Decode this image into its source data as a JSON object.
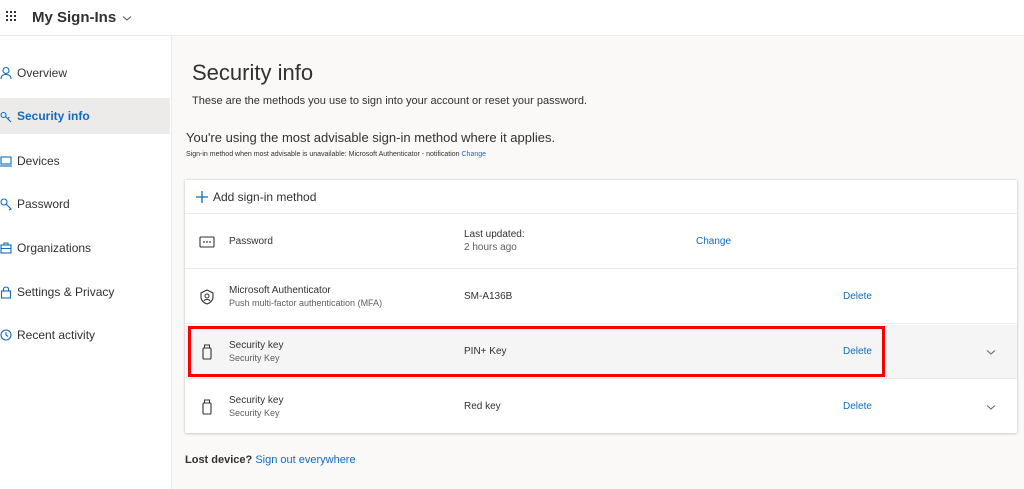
{
  "header": {
    "app_title": "My Sign-Ins",
    "icons": [
      "app-launcher-icon",
      "chevron-down-icon"
    ]
  },
  "sidebar": {
    "items": [
      {
        "label": "Overview",
        "icon": "person-icon",
        "active": false
      },
      {
        "label": "Security info",
        "icon": "key-pen-icon",
        "active": true
      },
      {
        "label": "Devices",
        "icon": "laptop-icon",
        "active": false
      },
      {
        "label": "Password",
        "icon": "password-key-icon",
        "active": false
      },
      {
        "label": "Organizations",
        "icon": "briefcase-icon",
        "active": false
      },
      {
        "label": "Settings & Privacy",
        "icon": "lock-icon",
        "active": false
      },
      {
        "label": "Recent activity",
        "icon": "clock-icon",
        "active": false
      }
    ]
  },
  "main": {
    "title": "Security info",
    "subtitle": "These are the methods you use to sign into your account or reset your password.",
    "advisable_text": "You're using the most advisable sign-in method where it applies.",
    "advisable_sub": "Sign-in method when most advisable is unavailable: Microsoft Authenticator - notification",
    "advisable_change": "Change",
    "add_method_label": "Add sign-in method",
    "methods": [
      {
        "name": "Password",
        "description": "",
        "icon": "password-dots-icon",
        "detail_top": "Last updated:",
        "detail_bottom": "2 hours ago",
        "action": "Change"
      },
      {
        "name": "Microsoft Authenticator",
        "description": "Push multi-factor authentication (MFA)",
        "icon": "authenticator-icon",
        "detail": "SM-A136B",
        "action": "Delete"
      },
      {
        "name": "Security key",
        "description": "Security Key",
        "icon": "usb-key-icon",
        "detail": "PIN+ Key",
        "action": "Delete",
        "highlighted": true
      },
      {
        "name": "Security key",
        "description": "Security Key",
        "icon": "usb-key-icon",
        "detail": "Red key",
        "action": "Delete"
      }
    ],
    "lost_device_label": "Lost device?",
    "sign_out_link": "Sign out everywhere"
  },
  "colors": {
    "accent": "#0f6cbd",
    "highlight_border": "#ff0000",
    "active_nav_bg": "#edebe9"
  }
}
